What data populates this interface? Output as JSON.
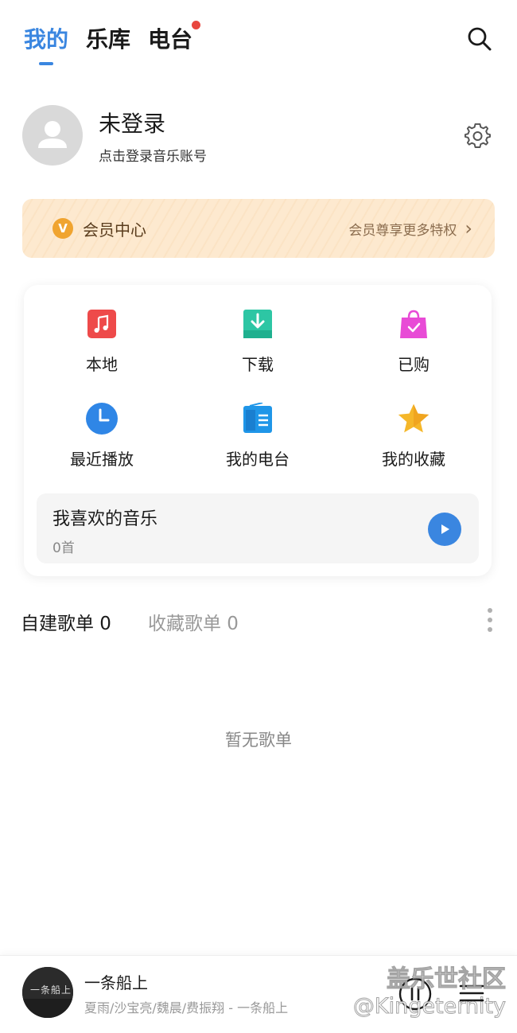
{
  "header": {
    "tabs": [
      {
        "label": "我的",
        "active": true
      },
      {
        "label": "乐库",
        "active": false
      },
      {
        "label": "电台",
        "active": false,
        "badge_dot": true
      }
    ],
    "search_icon": "search-icon"
  },
  "profile": {
    "name": "未登录",
    "subtitle": "点击登录音乐账号",
    "avatar_icon": "user-icon",
    "settings_icon": "gear-icon"
  },
  "member": {
    "badge": "V",
    "title": "会员中心",
    "promo": "会员尊享更多特权",
    "chevron": "›"
  },
  "quick_actions": [
    {
      "label": "本地",
      "icon": "music-note-icon",
      "color": "#ee4a4a"
    },
    {
      "label": "下载",
      "icon": "download-icon",
      "color": "#2dc6a4"
    },
    {
      "label": "已购",
      "icon": "shopping-bag-icon",
      "color": "#e84bd6"
    },
    {
      "label": "最近播放",
      "icon": "clock-icon",
      "color": "#2f86e6"
    },
    {
      "label": "我的电台",
      "icon": "radio-icon",
      "color": "#1f96e8"
    },
    {
      "label": "我的收藏",
      "icon": "star-icon",
      "color": "#f5b72a"
    }
  ],
  "favorites": {
    "title": "我喜欢的音乐",
    "count": "0首"
  },
  "playlist_tabs": {
    "created": "自建歌单 0",
    "collected": "收藏歌单 0"
  },
  "empty_text": "暂无歌单",
  "player": {
    "title": "一条船上",
    "artist": "夏雨/沙宝亮/魏晨/费振翔 - 一条船上",
    "cover_text": "一条船上"
  },
  "watermark": {
    "line1": "盖乐世社区",
    "line2": "@Kingeternity"
  },
  "colors": {
    "accent": "#3a86e0",
    "badge_dot": "#e8463e",
    "member_bg": "#fde9cf"
  }
}
